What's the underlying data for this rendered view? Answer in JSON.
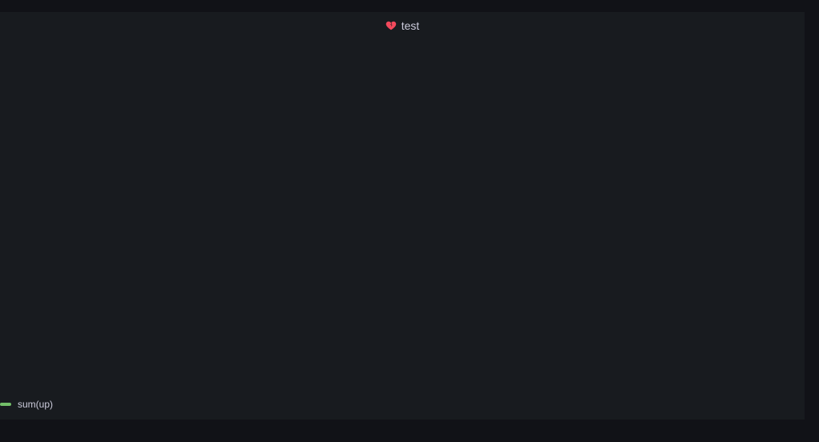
{
  "panel": {
    "title": "test",
    "title_icon": "broken-heart-icon",
    "accent_color": "#f2495c"
  },
  "legend": {
    "items": [
      {
        "label": "sum(up)",
        "color": "#73bf69"
      }
    ]
  },
  "theme": {
    "background": "#111217",
    "panel_background": "#181b1f",
    "text": "#ccccdc"
  }
}
